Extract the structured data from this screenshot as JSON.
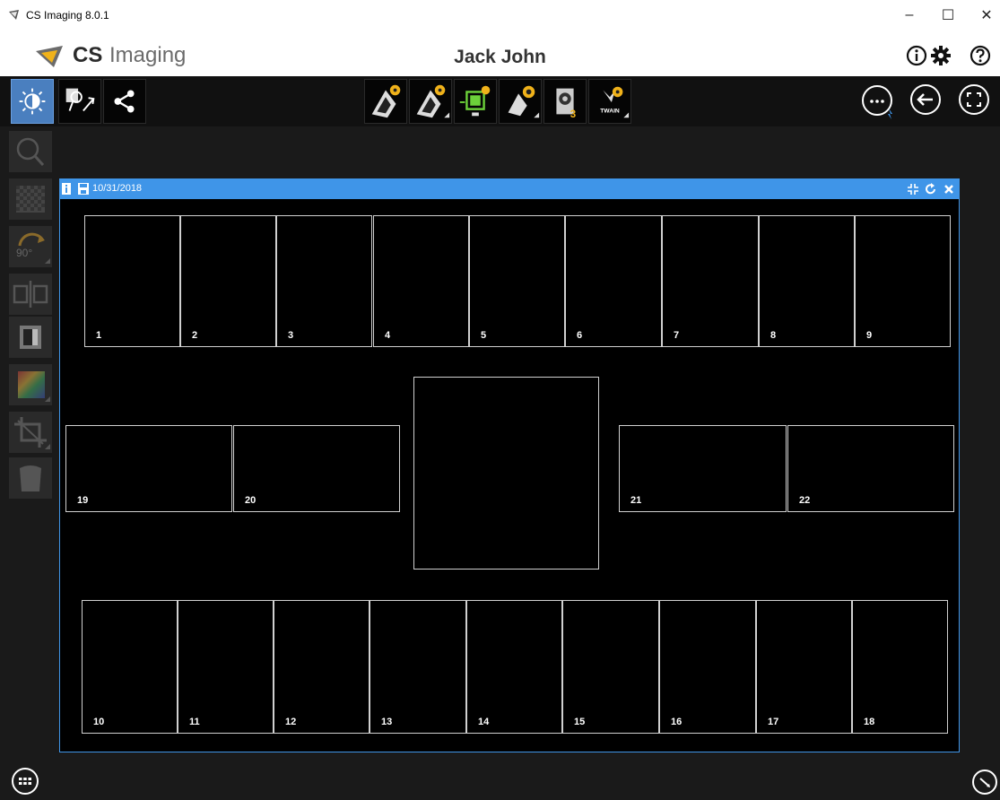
{
  "window": {
    "title": "CS Imaging 8.0.1"
  },
  "app": {
    "brand_bold": "CS",
    "brand_light": "Imaging",
    "patient_name": "Jack John"
  },
  "exam": {
    "date": "10/31/2018",
    "slots_top": [
      "1",
      "2",
      "3",
      "4",
      "5",
      "6",
      "7",
      "8",
      "9"
    ],
    "slots_bottom": [
      "10",
      "11",
      "12",
      "13",
      "14",
      "15",
      "16",
      "17",
      "18"
    ],
    "slots_mid_left": [
      "19",
      "20"
    ],
    "slots_mid_right": [
      "21",
      "22"
    ]
  },
  "toolbar": {
    "twain_label": "TWAIN"
  },
  "colors": {
    "accent": "#3f95e8",
    "active_tool": "#4a7fbf"
  }
}
